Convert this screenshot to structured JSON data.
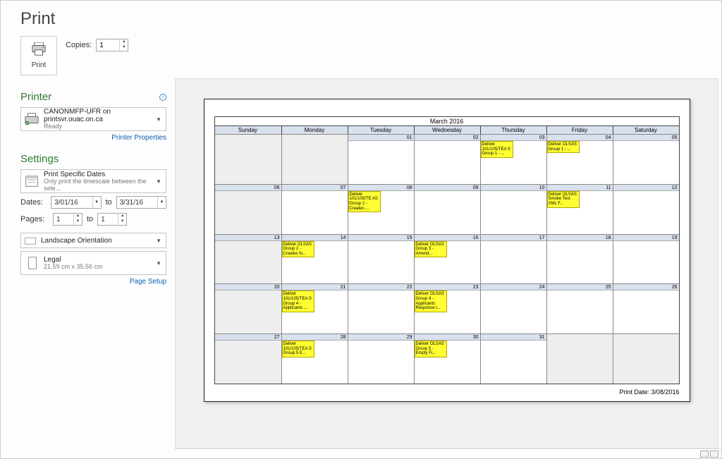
{
  "title": "Print",
  "printButtonLabel": "Print",
  "copies": {
    "label": "Copies:",
    "value": "1"
  },
  "printerSection": {
    "title": "Printer",
    "selected": {
      "main": "CANONMFP-UFR on printsvr.ouac.on.ca",
      "sub": "Ready"
    },
    "propertiesLink": "Printer Properties"
  },
  "settingsSection": {
    "title": "Settings",
    "printRange": {
      "main": "Print Specific Dates",
      "sub": "Only print the timescale between the sele..."
    },
    "dates": {
      "label": "Dates:",
      "from": "3/01/16",
      "toLabel": "to",
      "to": "3/31/16"
    },
    "pages": {
      "label": "Pages:",
      "from": "1",
      "toLabel": "to",
      "to": "1"
    },
    "orientation": {
      "main": "Landscape Orientation",
      "sub": ""
    },
    "paper": {
      "main": "Legal",
      "sub": "21.59 cm x 35.56 cm"
    },
    "pageSetupLink": "Page Setup"
  },
  "calendar": {
    "title": "March 2016",
    "days": [
      "Sunday",
      "Monday",
      "Tuesday",
      "Wednesday",
      "Thursday",
      "Friday",
      "Saturday"
    ],
    "rows": [
      {
        "cells": [
          {
            "np": true
          },
          {
            "np": true
          },
          {
            "d": "01"
          },
          {
            "d": "02"
          },
          {
            "d": "03",
            "event": "Deliver 101/105/TEA S Group 1 - ..."
          },
          {
            "d": "04",
            "event": "Deliver OLSAS Group 1 - ..."
          },
          {
            "d": "05"
          }
        ]
      },
      {
        "cells": [
          {
            "d": "06",
            "np": true
          },
          {
            "d": "07"
          },
          {
            "d": "08",
            "event": "Deliver 101/105/TE AS Group 2 - Creates ..."
          },
          {
            "d": "09"
          },
          {
            "d": "10"
          },
          {
            "d": "11",
            "event": "Deliver OLSAS Smoke Test XML F..."
          },
          {
            "d": "12"
          }
        ]
      },
      {
        "cells": [
          {
            "d": "13",
            "np": true
          },
          {
            "d": "14",
            "event": "Deliver OLSAS Group 2 - Creates fo..."
          },
          {
            "d": "15"
          },
          {
            "d": "16",
            "event": "Deliver OLSAS Group 3 - Amend..."
          },
          {
            "d": "17"
          },
          {
            "d": "18"
          },
          {
            "d": "19"
          }
        ]
      },
      {
        "cells": [
          {
            "d": "20",
            "np": true
          },
          {
            "d": "21",
            "event": "Deliver 101/105/TEA S Group 4 - Applicants ..."
          },
          {
            "d": "22"
          },
          {
            "d": "23",
            "event": "Deliver OLSAS Group 4 - Applicants Response t..."
          },
          {
            "d": "24"
          },
          {
            "d": "25"
          },
          {
            "d": "26"
          }
        ]
      },
      {
        "cells": [
          {
            "d": "27",
            "np": true
          },
          {
            "d": "28",
            "event": "Deliver 101/105/TEA S Group 5 E..."
          },
          {
            "d": "29"
          },
          {
            "d": "30",
            "event": "Deliver OLSAS Group 5 - Empty Fi..."
          },
          {
            "d": "31"
          },
          {
            "np": true
          },
          {
            "np": true
          }
        ]
      }
    ],
    "printDate": "Print Date: 3/08/2016"
  }
}
